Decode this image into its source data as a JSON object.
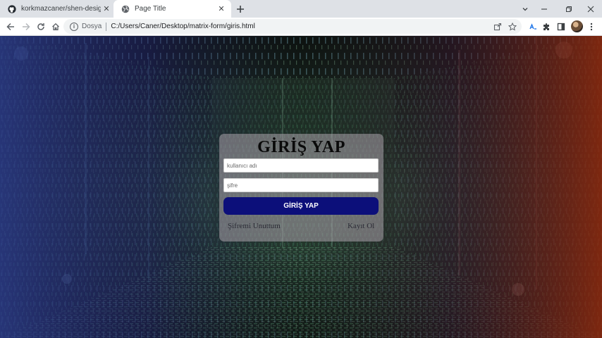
{
  "browser": {
    "tabs": [
      {
        "title": "korkmazcaner/shen-design",
        "icon": "github-icon",
        "active": false
      },
      {
        "title": "Page Title",
        "icon": "globe-icon",
        "active": true
      }
    ],
    "address": {
      "security_label": "Dosya",
      "url": "C:/Users/Caner/Desktop/matrix-form/giris.html"
    }
  },
  "login_form": {
    "title": "GİRİŞ YAP",
    "username_placeholder": "kullanıcı adı",
    "password_placeholder": "şifre",
    "submit_label": "GİRİŞ YAP",
    "forgot_password_label": "Şifremi Unuttum",
    "register_label": "Kayıt Ol"
  },
  "colors": {
    "submit_button": "#0c0f7a",
    "form_background": "rgba(170,160,170,0.55)",
    "background_left": "#2c3c8a",
    "background_right": "#8a2a10"
  }
}
